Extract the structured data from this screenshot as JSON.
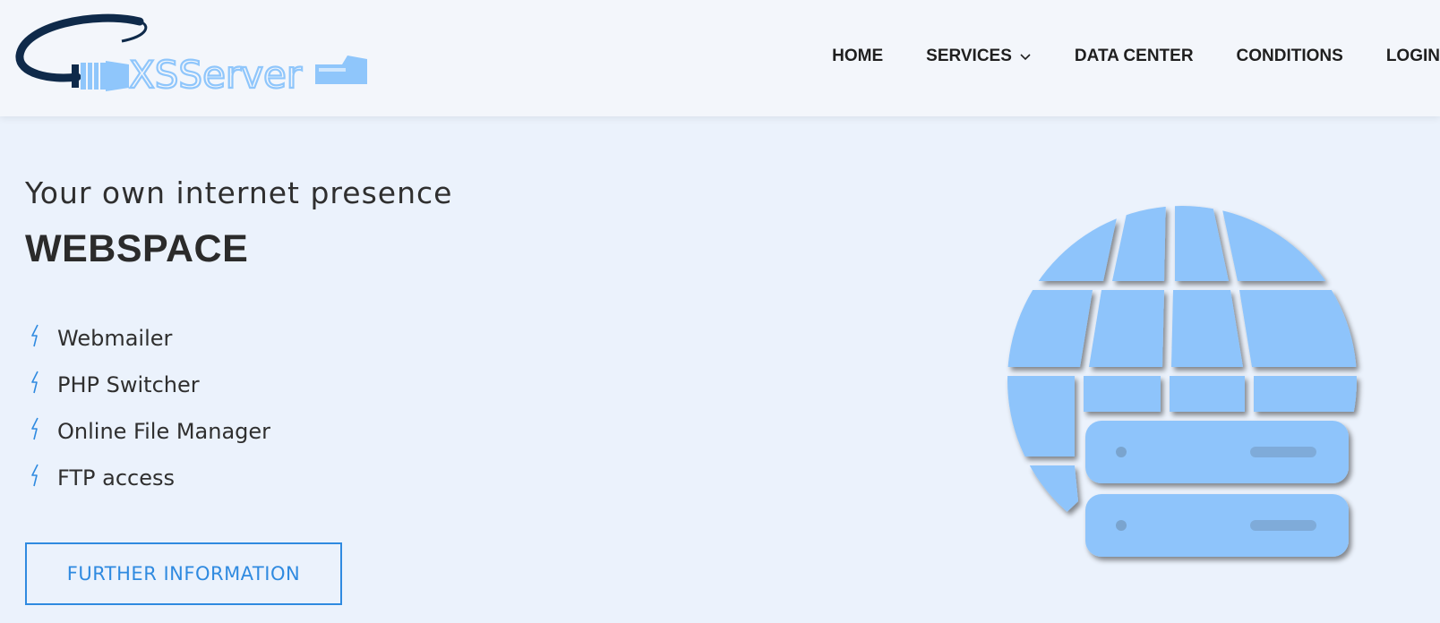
{
  "logo": {
    "text": "XSServer"
  },
  "nav": {
    "home": "HOME",
    "services": "SERVICES",
    "data_center": "DATA CENTER",
    "conditions": "CONDITIONS",
    "login": "LOGIN"
  },
  "hero": {
    "subtitle": "Your own internet presence",
    "title": "WEBSPACE",
    "features": [
      "Webmailer",
      "PHP Switcher",
      "Online File Manager",
      "FTP access"
    ],
    "cta_label": "FURTHER INFORMATION"
  },
  "icons": {
    "bullet": "lightning-bolt-icon",
    "dropdown": "chevron-down-icon",
    "hero": "globe-server-icon"
  },
  "colors": {
    "accent": "#2f8ae0",
    "logo_light": "#8fc6fb",
    "logo_dark": "#0f2a4a",
    "page_bg": "#ebf2fc",
    "header_bg": "#f3f6fb",
    "art_fill": "#8ec4fb"
  }
}
